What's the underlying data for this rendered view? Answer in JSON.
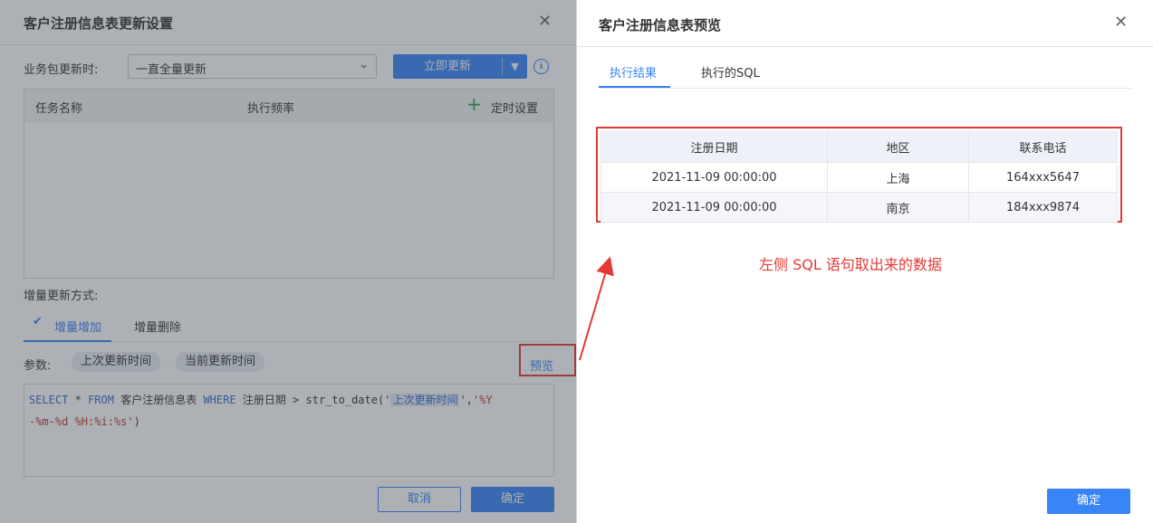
{
  "left_dialog": {
    "title": "客户注册信息表更新设置",
    "update_label": "业务包更新时:",
    "update_select_value": "一直全量更新",
    "update_now_label": "立即更新",
    "task_table": {
      "columns": [
        "任务名称",
        "执行频率",
        "定时设置"
      ]
    },
    "incremental_label": "增量更新方式:",
    "tabs": [
      "增量增加",
      "增量删除"
    ],
    "params_label": "参数:",
    "params": [
      "上次更新时间",
      "当前更新时间"
    ],
    "preview_label": "预览",
    "sql": {
      "kw_select": "SELECT",
      "star": "*",
      "kw_from": "FROM",
      "table_name": "客户注册信息表",
      "kw_where": "WHERE",
      "column": "注册日期",
      "func_open": "> str_to_date('",
      "param": "上次更新时间",
      "comma": "',",
      "format_part1": "'%Y",
      "format_part2": "-%m-%d %H:%i:%s'",
      "close": ")"
    },
    "cancel_label": "取消",
    "confirm_label": "确定"
  },
  "right_dialog": {
    "title": "客户注册信息表预览",
    "tabs": [
      "执行结果",
      "执行的SQL"
    ],
    "result_table": {
      "columns": [
        "注册日期",
        "地区",
        "联系电话"
      ],
      "rows": [
        [
          "2021-11-09 00:00:00",
          "上海",
          "164xxx5647"
        ],
        [
          "2021-11-09 00:00:00",
          "南京",
          "184xxx9874"
        ]
      ]
    },
    "annotation": "左侧 SQL 语句取出来的数据",
    "confirm_label": "确定"
  },
  "colors": {
    "accent": "#3885f8",
    "annotation_red": "#e53935",
    "add_green": "#23a352"
  },
  "icons": [
    "close-icon",
    "chevron-down-icon",
    "info-icon",
    "plus-icon",
    "check-icon",
    "arrow-annotation"
  ]
}
